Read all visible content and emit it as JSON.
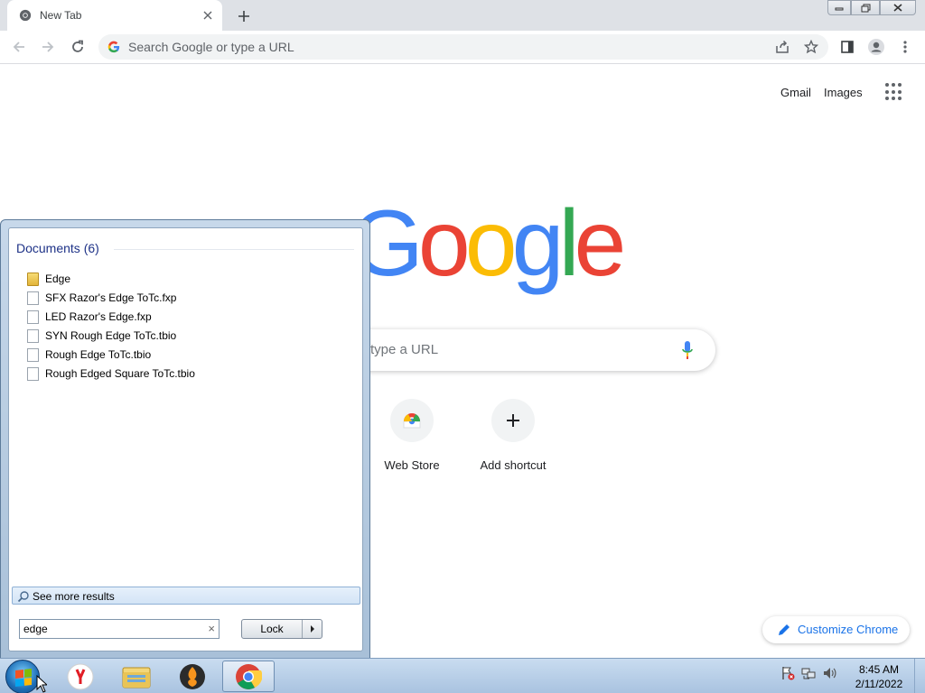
{
  "browser": {
    "tab_title": "New Tab",
    "omnibox_placeholder": "Search Google or type a URL"
  },
  "ntp": {
    "gmail_label": "Gmail",
    "images_label": "Images",
    "logo_text": "Google",
    "logo_colors": [
      "#4285f4",
      "#ea4335",
      "#fbbc05",
      "#4285f4",
      "#34a853",
      "#ea4335"
    ],
    "search_placeholder_visible": "type a URL",
    "shortcuts": [
      {
        "label": "Web Store",
        "icon": "chrome-web-store-icon"
      },
      {
        "label": "Add shortcut",
        "icon": "plus-icon"
      }
    ],
    "customize_label": "Customize Chrome"
  },
  "start_menu": {
    "heading": "Documents (6)",
    "items": [
      {
        "label": "Edge",
        "icon": "folder-icon"
      },
      {
        "label": "SFX Razor's Edge ToTc.fxp",
        "icon": "file-icon"
      },
      {
        "label": "LED Razor's Edge.fxp",
        "icon": "file-icon"
      },
      {
        "label": "SYN Rough Edge ToTc.tbio",
        "icon": "file-icon"
      },
      {
        "label": "Rough Edge ToTc.tbio",
        "icon": "file-icon"
      },
      {
        "label": "Rough Edged Square ToTc.tbio",
        "icon": "file-icon"
      }
    ],
    "see_more_label": "See more results",
    "search_value": "edge",
    "lock_label": "Lock"
  },
  "taskbar": {
    "apps": [
      "yandex-browser-icon",
      "windows-explorer-icon",
      "fl-studio-icon",
      "google-chrome-icon"
    ],
    "time": "8:45 AM",
    "date": "2/11/2022"
  },
  "colors": {
    "accent_blue": "#1a73e8",
    "start_heading": "#1e3287"
  }
}
